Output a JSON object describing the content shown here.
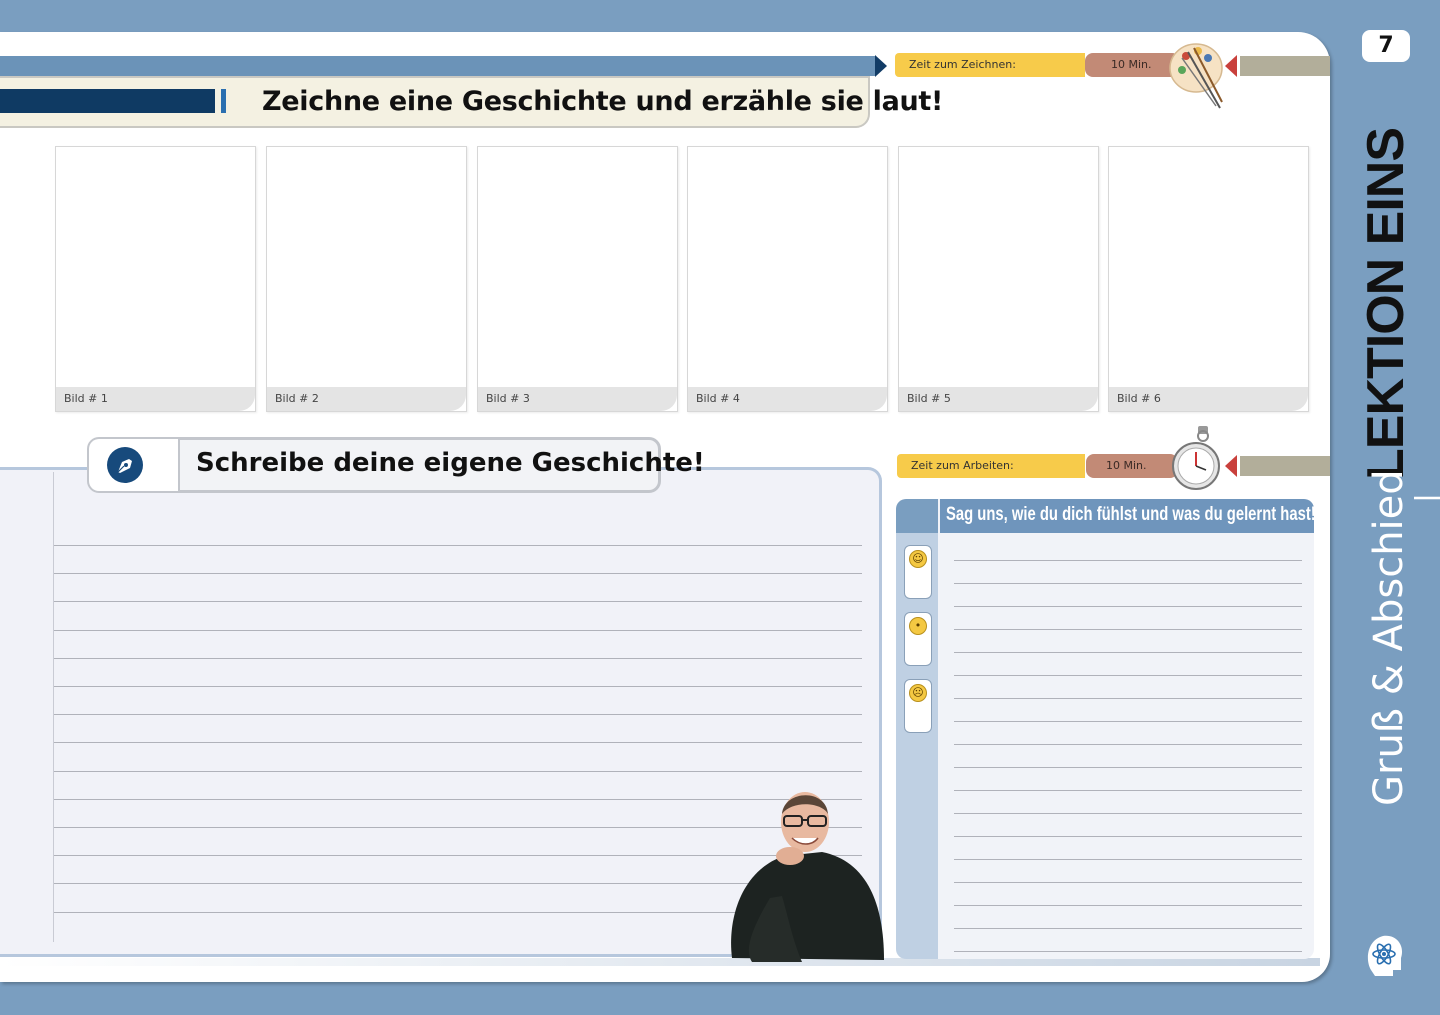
{
  "page": {
    "number": "7"
  },
  "drawing": {
    "title": "Zeichne eine Geschichte und erzähle sie laut!",
    "time_label": "Zeit zum Zeichnen:",
    "time_value": "10 Min.",
    "frames": [
      "Bild # 1",
      "Bild # 2",
      "Bild # 3",
      "Bild # 4",
      "Bild # 5",
      "Bild # 6"
    ]
  },
  "writing": {
    "title": "Schreibe deine eigene Geschichte!",
    "icon": "pen-icon",
    "line_count": 14
  },
  "work": {
    "time_label": "Zeit zum Arbeiten:",
    "time_value": "10 Min."
  },
  "feedback": {
    "title": "Sag uns, wie du dich fühlst und was du gelernt hast!",
    "moods": [
      "happy-face-icon",
      "neutral-face-icon",
      "sad-face-icon"
    ],
    "line_count": 18
  },
  "sidebar": {
    "lesson": "LEKTION EINS",
    "separator": "|",
    "topic": "Gruß & Abschied",
    "logo": "brain-icon"
  },
  "colors": {
    "frame_blue": "#7a9ec0",
    "dark_blue": "#0f3a63",
    "time_yellow": "#f7cb4a",
    "time_brown": "#c28a76",
    "accent_red": "#c9403c"
  }
}
